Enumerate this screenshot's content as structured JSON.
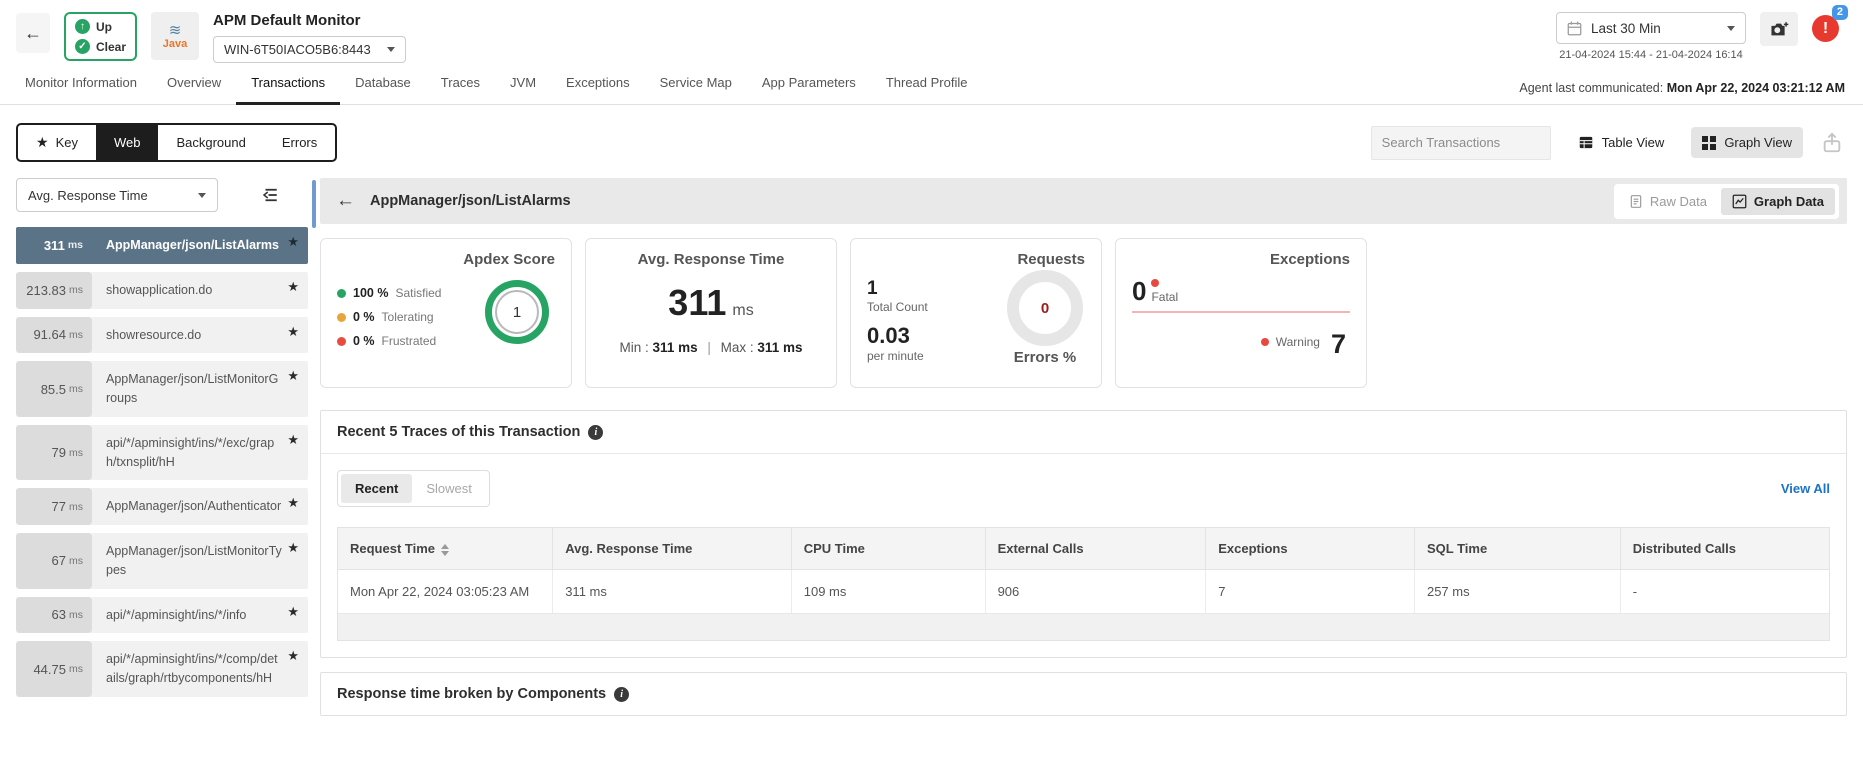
{
  "colors": {
    "accent_green": "#27a463",
    "alert_red": "#e8392e",
    "badge_blue": "#4596e8",
    "selected_row": "#5b7386",
    "link_blue": "#1a73c8",
    "warning_orange": "#e8a33d",
    "frustrated_red": "#e74c3c",
    "exception_pink": "#f3b3b8"
  },
  "icons": {
    "back_arrow": "←",
    "up_arrow": "↑",
    "check": "✓",
    "star": "★",
    "alert_exclaim": "!",
    "info": "i",
    "java_steam": "≋",
    "java_word": "Java"
  },
  "header": {
    "status": {
      "up": "Up",
      "clear": "Clear"
    },
    "title": "APM Default Monitor",
    "host_dropdown": "WIN-6T50IACO5B6:8443",
    "time_dropdown": "Last 30 Min",
    "time_range": "21-04-2024 15:44 - 21-04-2024 16:14",
    "alert_count": "2",
    "agent_label": "Agent last communicated:",
    "agent_value": "Mon Apr 22, 2024 03:21:12 AM"
  },
  "tabs": {
    "active": "Transactions",
    "items": [
      "Monitor Information",
      "Overview",
      "Transactions",
      "Database",
      "Traces",
      "JVM",
      "Exceptions",
      "Service Map",
      "App Parameters",
      "Thread Profile"
    ]
  },
  "toolbar": {
    "segments": [
      "Key",
      "Web",
      "Background",
      "Errors"
    ],
    "active_segment": "Web",
    "search_placeholder": "Search Transactions",
    "table_view": "Table View",
    "graph_view": "Graph View",
    "active_view": "Graph View"
  },
  "sidebar": {
    "metric_dropdown": "Avg. Response Time",
    "items": [
      {
        "value": "311",
        "unit": "ms",
        "name": "AppManager/json/ListAlarms",
        "selected": true
      },
      {
        "value": "213.83",
        "unit": "ms",
        "name": "showapplication.do",
        "selected": false
      },
      {
        "value": "91.64",
        "unit": "ms",
        "name": "showresource.do",
        "selected": false
      },
      {
        "value": "85.5",
        "unit": "ms",
        "name": "AppManager/json/ListMonitorGroups",
        "selected": false
      },
      {
        "value": "79",
        "unit": "ms",
        "name": "api/*/apminsight/ins/*/exc/graph/txnsplit/hH",
        "selected": false
      },
      {
        "value": "77",
        "unit": "ms",
        "name": "AppManager/json/Authenticator",
        "selected": false
      },
      {
        "value": "67",
        "unit": "ms",
        "name": "AppManager/json/ListMonitorTypes",
        "selected": false
      },
      {
        "value": "63",
        "unit": "ms",
        "name": "api/*/apminsight/ins/*/info",
        "selected": false
      },
      {
        "value": "44.75",
        "unit": "ms",
        "name": "api/*/apminsight/ins/*/comp/details/graph/rtbycomponents/hH",
        "selected": false
      }
    ]
  },
  "main": {
    "title": "AppManager/json/ListAlarms",
    "raw_data": "Raw Data",
    "graph_data": "Graph Data",
    "cards": {
      "apdex": {
        "title": "Apdex Score",
        "score": "1",
        "legend": [
          {
            "pct": "100 %",
            "label": "Satisfied",
            "color": "#27a463"
          },
          {
            "pct": "0 %",
            "label": "Tolerating",
            "color": "#e8a33d"
          },
          {
            "pct": "0 %",
            "label": "Frustrated",
            "color": "#e74c3c"
          }
        ]
      },
      "avg_response": {
        "title": "Avg. Response Time",
        "value": "311",
        "unit": "ms",
        "min_label": "Min :",
        "min_value": "311 ms",
        "max_label": "Max :",
        "max_value": "311 ms"
      },
      "requests": {
        "title": "Requests",
        "total": "1",
        "total_label": "Total Count",
        "per_minute": "0.03",
        "per_minute_label": "per minute",
        "errors_value": "0",
        "errors_label": "Errors %"
      },
      "exceptions": {
        "title": "Exceptions",
        "fatal_value": "0",
        "fatal_label": "Fatal",
        "warning_label": "Warning",
        "warning_value": "7"
      }
    },
    "traces": {
      "title": "Recent 5 Traces of this Transaction",
      "toggle": [
        "Recent",
        "Slowest"
      ],
      "active_toggle": "Recent",
      "view_all": "View All",
      "columns": [
        "Request Time",
        "Avg. Response Time",
        "CPU Time",
        "External Calls",
        "Exceptions",
        "SQL Time",
        "Distributed Calls"
      ],
      "rows": [
        [
          "Mon Apr 22, 2024 03:05:23 AM",
          "311 ms",
          "109 ms",
          "906",
          "7",
          "257 ms",
          "-"
        ]
      ]
    },
    "components": {
      "title": "Response time broken by Components"
    }
  }
}
